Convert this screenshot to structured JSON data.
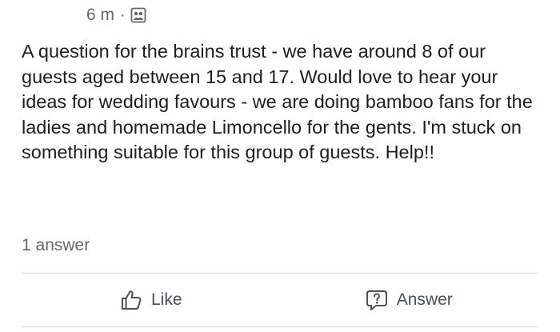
{
  "post": {
    "timestamp": "6 m",
    "separator": "·",
    "audience_icon": "group-icon",
    "text": "A question for the brains trust - we have around 8 of our guests aged between 15 and 17. Would love to hear your ideas for wedding favours - we are doing bamboo fans for the ladies and homemade Limoncello for the gents. I'm stuck on something suitable for this group of guests. Help!!",
    "answer_count": "1 answer"
  },
  "actions": {
    "like": {
      "label": "Like",
      "icon": "thumbs-up-icon"
    },
    "answer": {
      "label": "Answer",
      "icon": "question-bubble-icon"
    }
  },
  "colors": {
    "text": "#1c1e21",
    "secondary": "#65676b",
    "divider": "#d4d6da"
  }
}
